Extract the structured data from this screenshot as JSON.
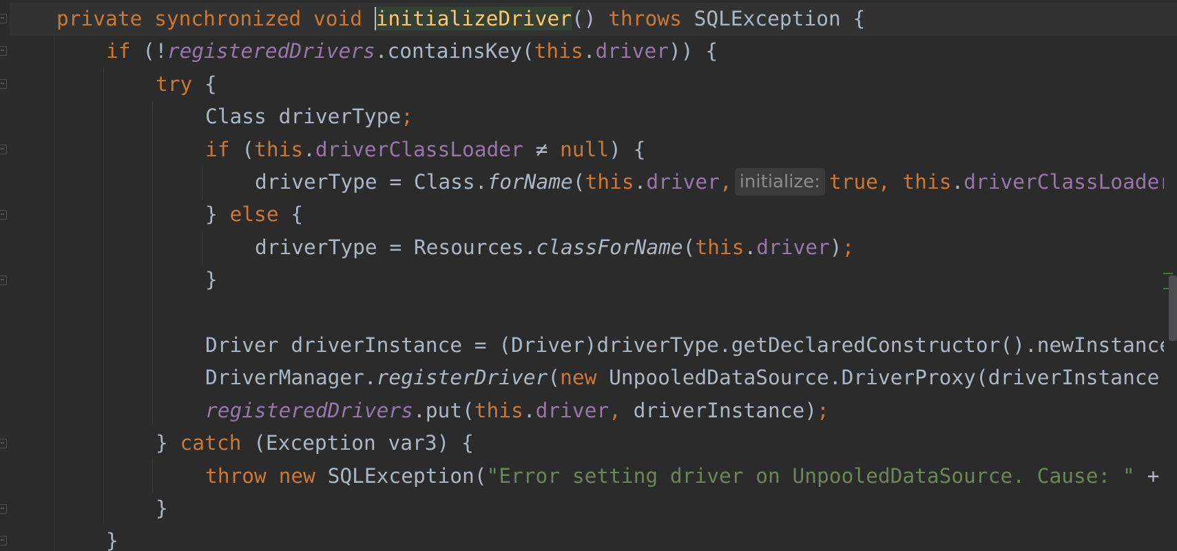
{
  "editor": {
    "lines": [
      {
        "indent": 0,
        "tokens": [
          {
            "t": "private ",
            "c": "kw"
          },
          {
            "t": "synchronized ",
            "c": "kw"
          },
          {
            "t": "void ",
            "c": "kw"
          },
          {
            "t": "initializeDriver",
            "c": "fn cursor-word"
          },
          {
            "t": "() ",
            "c": "plain"
          },
          {
            "t": "throws ",
            "c": "kw"
          },
          {
            "t": "SQLException {",
            "c": "plain"
          }
        ]
      },
      {
        "indent": 1,
        "tokens": [
          {
            "t": "if ",
            "c": "kw"
          },
          {
            "t": "(!",
            "c": "plain"
          },
          {
            "t": "registeredDrivers",
            "c": "sfld"
          },
          {
            "t": ".containsKey(",
            "c": "plain"
          },
          {
            "t": "this",
            "c": "kw"
          },
          {
            "t": ".",
            "c": "plain"
          },
          {
            "t": "driver",
            "c": "fld"
          },
          {
            "t": ")) {",
            "c": "plain"
          }
        ]
      },
      {
        "indent": 2,
        "tokens": [
          {
            "t": "try ",
            "c": "kw"
          },
          {
            "t": "{",
            "c": "plain"
          }
        ]
      },
      {
        "indent": 3,
        "tokens": [
          {
            "t": "Class driverType",
            "c": "plain"
          },
          {
            "t": ";",
            "c": "semi"
          }
        ]
      },
      {
        "indent": 3,
        "tokens": [
          {
            "t": "if ",
            "c": "kw"
          },
          {
            "t": "(",
            "c": "plain"
          },
          {
            "t": "this",
            "c": "kw"
          },
          {
            "t": ".",
            "c": "plain"
          },
          {
            "t": "driverClassLoader",
            "c": "fld"
          },
          {
            "t": " ≠ ",
            "c": "plain"
          },
          {
            "t": "null",
            "c": "kw"
          },
          {
            "t": ") {",
            "c": "plain"
          }
        ]
      },
      {
        "indent": 4,
        "tokens": [
          {
            "t": "driverType = Class.",
            "c": "plain"
          },
          {
            "t": "forName",
            "c": "plain stat"
          },
          {
            "t": "(",
            "c": "plain"
          },
          {
            "t": "this",
            "c": "kw"
          },
          {
            "t": ".",
            "c": "plain"
          },
          {
            "t": "driver",
            "c": "fld"
          },
          {
            "t": ",",
            "c": "semi"
          },
          {
            "t": "initialize:",
            "c": "hint"
          },
          {
            "t": "true",
            "c": "kw"
          },
          {
            "t": ", ",
            "c": "semi"
          },
          {
            "t": "this",
            "c": "kw"
          },
          {
            "t": ".",
            "c": "plain"
          },
          {
            "t": "driverClassLoader",
            "c": "fld"
          }
        ]
      },
      {
        "indent": 3,
        "tokens": [
          {
            "t": "} ",
            "c": "plain"
          },
          {
            "t": "else ",
            "c": "kw"
          },
          {
            "t": "{",
            "c": "plain"
          }
        ]
      },
      {
        "indent": 4,
        "tokens": [
          {
            "t": "driverType = Resources.",
            "c": "plain"
          },
          {
            "t": "classForName",
            "c": "plain stat"
          },
          {
            "t": "(",
            "c": "plain"
          },
          {
            "t": "this",
            "c": "kw"
          },
          {
            "t": ".",
            "c": "plain"
          },
          {
            "t": "driver",
            "c": "fld"
          },
          {
            "t": ")",
            "c": "plain"
          },
          {
            "t": ";",
            "c": "semi"
          }
        ]
      },
      {
        "indent": 3,
        "tokens": [
          {
            "t": "}",
            "c": "plain"
          }
        ]
      },
      {
        "indent": 0,
        "tokens": []
      },
      {
        "indent": 3,
        "tokens": [
          {
            "t": "Driver driverInstance = (Driver)driverType.getDeclaredConstructor().newInstance",
            "c": "plain"
          }
        ]
      },
      {
        "indent": 3,
        "tokens": [
          {
            "t": "DriverManager.",
            "c": "plain"
          },
          {
            "t": "registerDriver",
            "c": "plain stat"
          },
          {
            "t": "(",
            "c": "plain"
          },
          {
            "t": "new ",
            "c": "kw"
          },
          {
            "t": "UnpooledDataSource.DriverProxy(driverInstance",
            "c": "plain"
          }
        ]
      },
      {
        "indent": 3,
        "tokens": [
          {
            "t": "registeredDrivers",
            "c": "sfld"
          },
          {
            "t": ".put(",
            "c": "plain"
          },
          {
            "t": "this",
            "c": "kw"
          },
          {
            "t": ".",
            "c": "plain"
          },
          {
            "t": "driver",
            "c": "fld"
          },
          {
            "t": ", ",
            "c": "semi"
          },
          {
            "t": "driverInstance)",
            "c": "plain"
          },
          {
            "t": ";",
            "c": "semi"
          }
        ]
      },
      {
        "indent": 2,
        "tokens": [
          {
            "t": "} ",
            "c": "plain"
          },
          {
            "t": "catch ",
            "c": "kw"
          },
          {
            "t": "(Exception var3) {",
            "c": "plain"
          }
        ]
      },
      {
        "indent": 3,
        "tokens": [
          {
            "t": "throw ",
            "c": "kw"
          },
          {
            "t": "new ",
            "c": "kw"
          },
          {
            "t": "SQLException(",
            "c": "plain"
          },
          {
            "t": "\"Error setting driver on UnpooledDataSource. Cause: \"",
            "c": "str"
          },
          {
            "t": " +",
            "c": "plain"
          }
        ]
      },
      {
        "indent": 2,
        "tokens": [
          {
            "t": "}",
            "c": "plain"
          }
        ]
      },
      {
        "indent": 1,
        "tokens": [
          {
            "t": "}",
            "c": "plain"
          }
        ]
      }
    ]
  }
}
